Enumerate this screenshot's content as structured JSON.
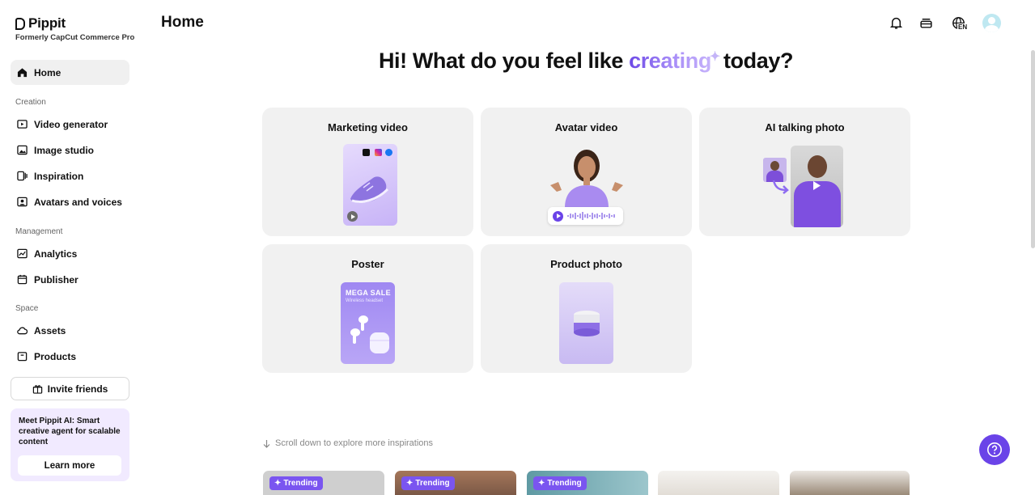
{
  "app": {
    "name": "Pippit",
    "subtitle": "Formerly CapCut Commerce Pro",
    "page_title": "Home"
  },
  "sidebar": {
    "home": "Home",
    "creation_label": "Creation",
    "creation": [
      "Video generator",
      "Image studio",
      "Inspiration",
      "Avatars and voices"
    ],
    "management_label": "Management",
    "management": [
      "Analytics",
      "Publisher"
    ],
    "space_label": "Space",
    "space": [
      "Assets",
      "Products"
    ],
    "invite": "Invite friends",
    "promo_text": "Meet Pippit AI: Smart creative agent for scalable content",
    "promo_button": "Learn more"
  },
  "header": {
    "language": "EN"
  },
  "hero": {
    "pre": "Hi! What do you feel like ",
    "highlight": "creating",
    "post": "today?"
  },
  "cards": {
    "marketing": "Marketing video",
    "avatar": "Avatar video",
    "talking": "AI talking photo",
    "poster": "Poster",
    "product": "Product photo",
    "poster_headline": "MEGA SALE",
    "poster_sub": "Wireless headset"
  },
  "scroll_hint": "Scroll down to explore more inspirations",
  "trending_label": "Trending",
  "colors": {
    "accent": "#6a43e8",
    "card_bg": "#f1f1f1",
    "purple_light": "#d9cdfa"
  }
}
